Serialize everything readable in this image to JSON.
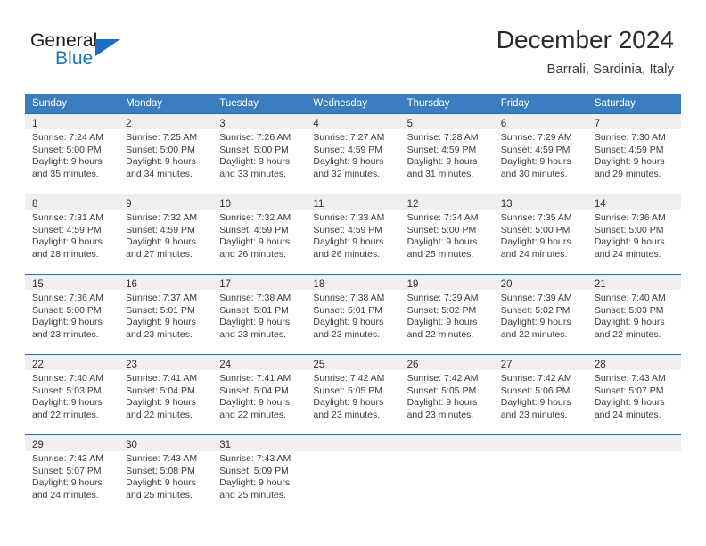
{
  "brand": {
    "word_one": "General",
    "word_two": "Blue",
    "triangle_icon": "triangle-icon",
    "colors": {
      "blue": "#1b74bb",
      "dark": "#1a1a1a"
    }
  },
  "header": {
    "title": "December 2024",
    "subtitle": "Barrali, Sardinia, Italy"
  },
  "calendar": {
    "weekday_headers": [
      "Sunday",
      "Monday",
      "Tuesday",
      "Wednesday",
      "Thursday",
      "Friday",
      "Saturday"
    ],
    "header_bg": "#3a7ebf",
    "row_rule_color": "#1f6db5",
    "daynum_strip_bg": "#efefef",
    "weeks": [
      [
        {
          "day": "1",
          "sunrise": "Sunrise: 7:24 AM",
          "sunset": "Sunset: 5:00 PM",
          "daylight_1": "Daylight: 9 hours",
          "daylight_2": "and 35 minutes."
        },
        {
          "day": "2",
          "sunrise": "Sunrise: 7:25 AM",
          "sunset": "Sunset: 5:00 PM",
          "daylight_1": "Daylight: 9 hours",
          "daylight_2": "and 34 minutes."
        },
        {
          "day": "3",
          "sunrise": "Sunrise: 7:26 AM",
          "sunset": "Sunset: 5:00 PM",
          "daylight_1": "Daylight: 9 hours",
          "daylight_2": "and 33 minutes."
        },
        {
          "day": "4",
          "sunrise": "Sunrise: 7:27 AM",
          "sunset": "Sunset: 4:59 PM",
          "daylight_1": "Daylight: 9 hours",
          "daylight_2": "and 32 minutes."
        },
        {
          "day": "5",
          "sunrise": "Sunrise: 7:28 AM",
          "sunset": "Sunset: 4:59 PM",
          "daylight_1": "Daylight: 9 hours",
          "daylight_2": "and 31 minutes."
        },
        {
          "day": "6",
          "sunrise": "Sunrise: 7:29 AM",
          "sunset": "Sunset: 4:59 PM",
          "daylight_1": "Daylight: 9 hours",
          "daylight_2": "and 30 minutes."
        },
        {
          "day": "7",
          "sunrise": "Sunrise: 7:30 AM",
          "sunset": "Sunset: 4:59 PM",
          "daylight_1": "Daylight: 9 hours",
          "daylight_2": "and 29 minutes."
        }
      ],
      [
        {
          "day": "8",
          "sunrise": "Sunrise: 7:31 AM",
          "sunset": "Sunset: 4:59 PM",
          "daylight_1": "Daylight: 9 hours",
          "daylight_2": "and 28 minutes."
        },
        {
          "day": "9",
          "sunrise": "Sunrise: 7:32 AM",
          "sunset": "Sunset: 4:59 PM",
          "daylight_1": "Daylight: 9 hours",
          "daylight_2": "and 27 minutes."
        },
        {
          "day": "10",
          "sunrise": "Sunrise: 7:32 AM",
          "sunset": "Sunset: 4:59 PM",
          "daylight_1": "Daylight: 9 hours",
          "daylight_2": "and 26 minutes."
        },
        {
          "day": "11",
          "sunrise": "Sunrise: 7:33 AM",
          "sunset": "Sunset: 4:59 PM",
          "daylight_1": "Daylight: 9 hours",
          "daylight_2": "and 26 minutes."
        },
        {
          "day": "12",
          "sunrise": "Sunrise: 7:34 AM",
          "sunset": "Sunset: 5:00 PM",
          "daylight_1": "Daylight: 9 hours",
          "daylight_2": "and 25 minutes."
        },
        {
          "day": "13",
          "sunrise": "Sunrise: 7:35 AM",
          "sunset": "Sunset: 5:00 PM",
          "daylight_1": "Daylight: 9 hours",
          "daylight_2": "and 24 minutes."
        },
        {
          "day": "14",
          "sunrise": "Sunrise: 7:36 AM",
          "sunset": "Sunset: 5:00 PM",
          "daylight_1": "Daylight: 9 hours",
          "daylight_2": "and 24 minutes."
        }
      ],
      [
        {
          "day": "15",
          "sunrise": "Sunrise: 7:36 AM",
          "sunset": "Sunset: 5:00 PM",
          "daylight_1": "Daylight: 9 hours",
          "daylight_2": "and 23 minutes."
        },
        {
          "day": "16",
          "sunrise": "Sunrise: 7:37 AM",
          "sunset": "Sunset: 5:01 PM",
          "daylight_1": "Daylight: 9 hours",
          "daylight_2": "and 23 minutes."
        },
        {
          "day": "17",
          "sunrise": "Sunrise: 7:38 AM",
          "sunset": "Sunset: 5:01 PM",
          "daylight_1": "Daylight: 9 hours",
          "daylight_2": "and 23 minutes."
        },
        {
          "day": "18",
          "sunrise": "Sunrise: 7:38 AM",
          "sunset": "Sunset: 5:01 PM",
          "daylight_1": "Daylight: 9 hours",
          "daylight_2": "and 23 minutes."
        },
        {
          "day": "19",
          "sunrise": "Sunrise: 7:39 AM",
          "sunset": "Sunset: 5:02 PM",
          "daylight_1": "Daylight: 9 hours",
          "daylight_2": "and 22 minutes."
        },
        {
          "day": "20",
          "sunrise": "Sunrise: 7:39 AM",
          "sunset": "Sunset: 5:02 PM",
          "daylight_1": "Daylight: 9 hours",
          "daylight_2": "and 22 minutes."
        },
        {
          "day": "21",
          "sunrise": "Sunrise: 7:40 AM",
          "sunset": "Sunset: 5:03 PM",
          "daylight_1": "Daylight: 9 hours",
          "daylight_2": "and 22 minutes."
        }
      ],
      [
        {
          "day": "22",
          "sunrise": "Sunrise: 7:40 AM",
          "sunset": "Sunset: 5:03 PM",
          "daylight_1": "Daylight: 9 hours",
          "daylight_2": "and 22 minutes."
        },
        {
          "day": "23",
          "sunrise": "Sunrise: 7:41 AM",
          "sunset": "Sunset: 5:04 PM",
          "daylight_1": "Daylight: 9 hours",
          "daylight_2": "and 22 minutes."
        },
        {
          "day": "24",
          "sunrise": "Sunrise: 7:41 AM",
          "sunset": "Sunset: 5:04 PM",
          "daylight_1": "Daylight: 9 hours",
          "daylight_2": "and 22 minutes."
        },
        {
          "day": "25",
          "sunrise": "Sunrise: 7:42 AM",
          "sunset": "Sunset: 5:05 PM",
          "daylight_1": "Daylight: 9 hours",
          "daylight_2": "and 23 minutes."
        },
        {
          "day": "26",
          "sunrise": "Sunrise: 7:42 AM",
          "sunset": "Sunset: 5:05 PM",
          "daylight_1": "Daylight: 9 hours",
          "daylight_2": "and 23 minutes."
        },
        {
          "day": "27",
          "sunrise": "Sunrise: 7:42 AM",
          "sunset": "Sunset: 5:06 PM",
          "daylight_1": "Daylight: 9 hours",
          "daylight_2": "and 23 minutes."
        },
        {
          "day": "28",
          "sunrise": "Sunrise: 7:43 AM",
          "sunset": "Sunset: 5:07 PM",
          "daylight_1": "Daylight: 9 hours",
          "daylight_2": "and 24 minutes."
        }
      ],
      [
        {
          "day": "29",
          "sunrise": "Sunrise: 7:43 AM",
          "sunset": "Sunset: 5:07 PM",
          "daylight_1": "Daylight: 9 hours",
          "daylight_2": "and 24 minutes."
        },
        {
          "day": "30",
          "sunrise": "Sunrise: 7:43 AM",
          "sunset": "Sunset: 5:08 PM",
          "daylight_1": "Daylight: 9 hours",
          "daylight_2": "and 25 minutes."
        },
        {
          "day": "31",
          "sunrise": "Sunrise: 7:43 AM",
          "sunset": "Sunset: 5:09 PM",
          "daylight_1": "Daylight: 9 hours",
          "daylight_2": "and 25 minutes."
        },
        {
          "day": "",
          "sunrise": "",
          "sunset": "",
          "daylight_1": "",
          "daylight_2": ""
        },
        {
          "day": "",
          "sunrise": "",
          "sunset": "",
          "daylight_1": "",
          "daylight_2": ""
        },
        {
          "day": "",
          "sunrise": "",
          "sunset": "",
          "daylight_1": "",
          "daylight_2": ""
        },
        {
          "day": "",
          "sunrise": "",
          "sunset": "",
          "daylight_1": "",
          "daylight_2": ""
        }
      ]
    ]
  }
}
